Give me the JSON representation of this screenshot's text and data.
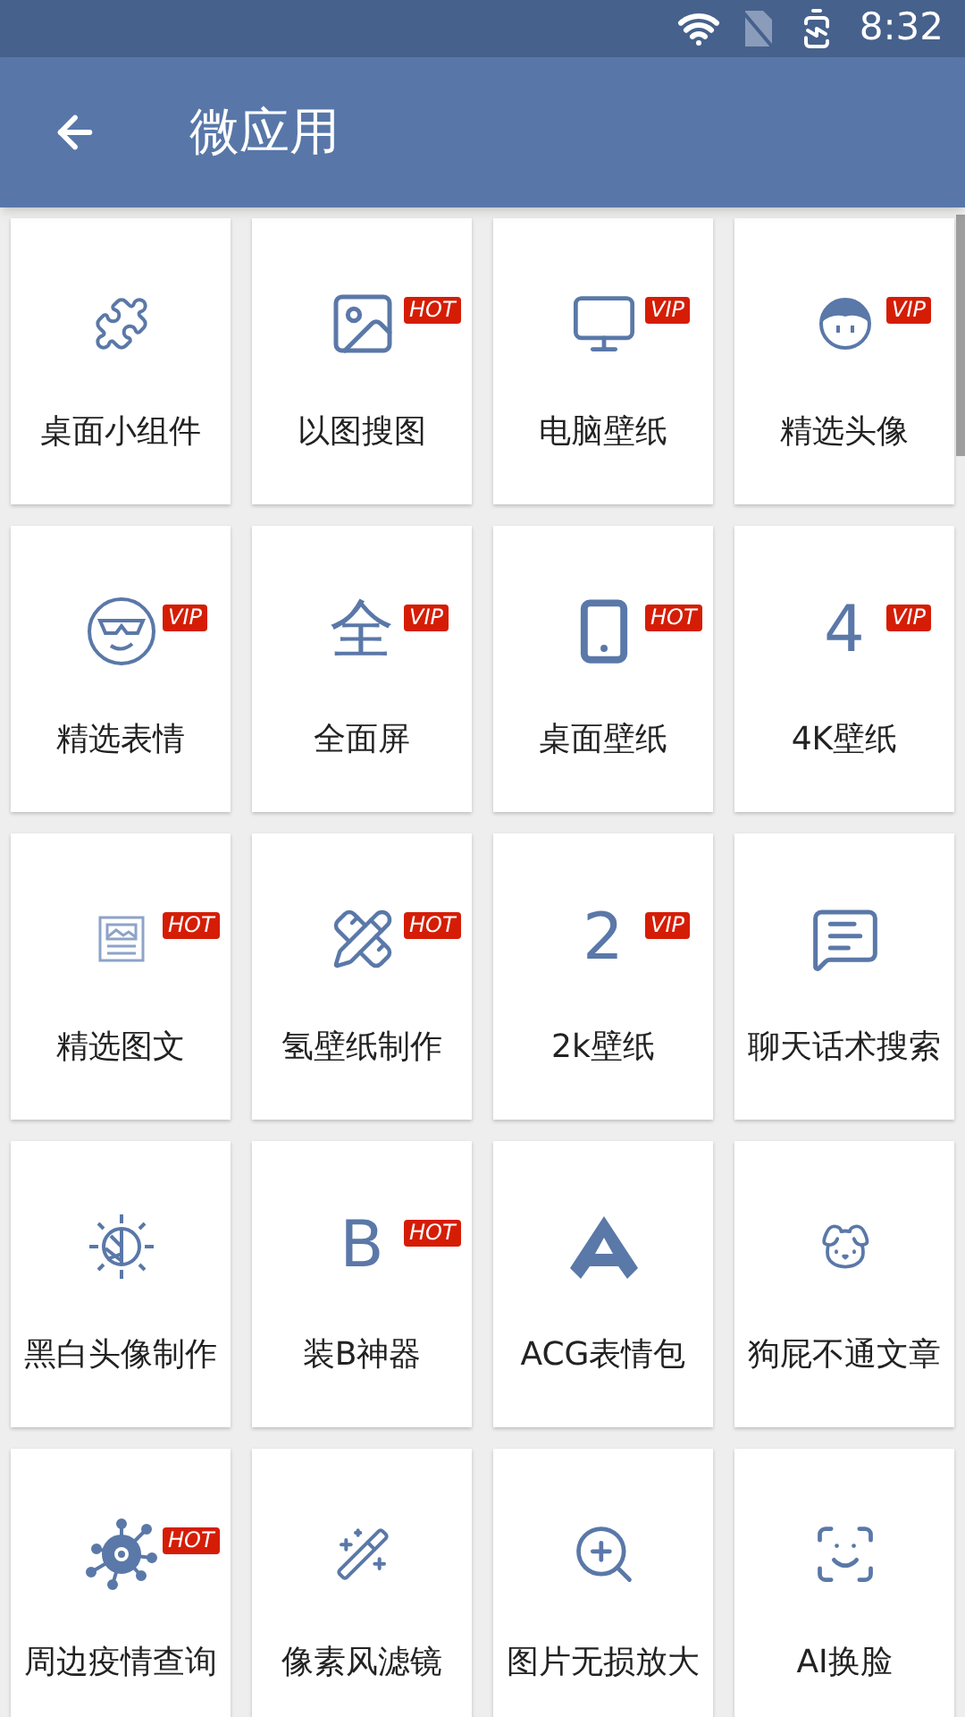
{
  "status_bar": {
    "time": "8:32"
  },
  "app_bar": {
    "title": "微应用"
  },
  "items": [
    {
      "label": "桌面小组件",
      "kind": "puzzle"
    },
    {
      "label": "以图搜图",
      "kind": "image",
      "badge": "HOT"
    },
    {
      "label": "电脑壁纸",
      "kind": "monitor",
      "badge": "VIP"
    },
    {
      "label": "精选头像",
      "kind": "avatar",
      "badge": "VIP"
    },
    {
      "label": "精选表情",
      "kind": "sunglasses",
      "badge": "VIP"
    },
    {
      "label": "全面屏",
      "kind": "glyph",
      "glyph": "全",
      "badge": "VIP"
    },
    {
      "label": "桌面壁纸",
      "kind": "phone",
      "badge": "HOT"
    },
    {
      "label": "4K壁纸",
      "kind": "glyph",
      "glyph": "4",
      "badge": "VIP"
    },
    {
      "label": "精选图文",
      "kind": "article",
      "badge": "HOT"
    },
    {
      "label": "氢壁纸制作",
      "kind": "ruler",
      "badge": "HOT"
    },
    {
      "label": "2k壁纸",
      "kind": "glyph",
      "glyph": "2",
      "badge": "VIP"
    },
    {
      "label": "聊天话术搜索",
      "kind": "chat"
    },
    {
      "label": "黑白头像制作",
      "kind": "contrast"
    },
    {
      "label": "装B神器",
      "kind": "glyph",
      "glyph": "B",
      "badge": "HOT"
    },
    {
      "label": "ACG表情包",
      "kind": "triangle"
    },
    {
      "label": "狗屁不通文章",
      "kind": "dog"
    },
    {
      "label": "周边疫情查询",
      "kind": "virus",
      "badge": "HOT"
    },
    {
      "label": "像素风滤镜",
      "kind": "wand"
    },
    {
      "label": "图片无损放大",
      "kind": "zoom"
    },
    {
      "label": "AI换脸",
      "kind": "scan"
    }
  ]
}
